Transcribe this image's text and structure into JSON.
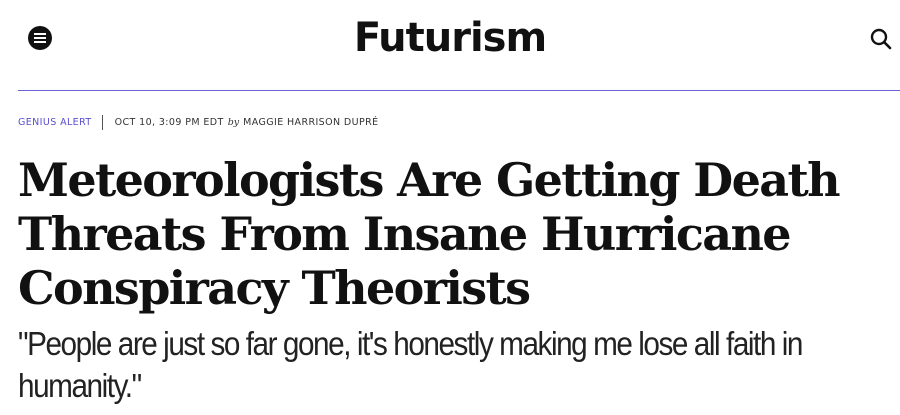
{
  "header": {
    "logo_text": "Futurism",
    "menu_icon": "hamburger-menu-icon",
    "search_icon": "search-icon"
  },
  "article": {
    "category": "GENIUS ALERT",
    "date": "OCT 10, 3:09 PM EDT",
    "by": "by",
    "author": "MAGGIE HARRISON DUPRÉ",
    "headline": "Meteorologists Are Getting Death Threats From Insane Hurricane Conspiracy Theorists",
    "dek": "\"People are just so far gone, it's honestly making me lose all faith in humanity.\""
  },
  "colors": {
    "accent": "#5a4fcf",
    "divider": "#6a62d6",
    "text": "#111111"
  }
}
